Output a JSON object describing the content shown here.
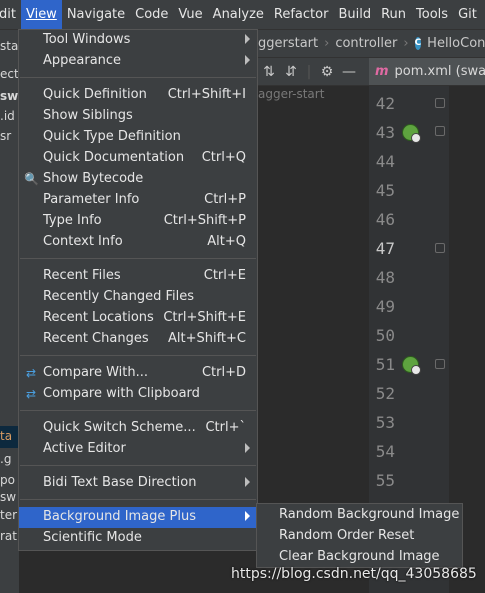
{
  "menubar": {
    "items": [
      "dit",
      "View",
      "Navigate",
      "Code",
      "Vue",
      "Analyze",
      "Refactor",
      "Build",
      "Run",
      "Tools",
      "Git",
      "W"
    ]
  },
  "breadcrumbs": [
    "ggerstart",
    "controller",
    "HelloContro"
  ],
  "tab": {
    "label": "pom.xml (swag"
  },
  "left_panel": {
    "texts": [
      "start",
      "ect",
      "swag",
      ".id",
      "sr",
      "ta",
      ".g",
      "po",
      "sw",
      "ter",
      "rat"
    ]
  },
  "project_label": "agger-start",
  "line_numbers": [
    "42",
    "43",
    "44",
    "45",
    "46",
    "47",
    "48",
    "49",
    "50",
    "51",
    "52",
    "53",
    "54",
    "55"
  ],
  "view_menu": {
    "groups": [
      [
        {
          "label": "Tool Windows",
          "shortcut": "",
          "submenu": true
        },
        {
          "label": "Appearance",
          "shortcut": "",
          "submenu": true
        }
      ],
      [
        {
          "label": "Quick Definition",
          "shortcut": "Ctrl+Shift+I"
        },
        {
          "label": "Show Siblings",
          "shortcut": ""
        },
        {
          "label": "Quick Type Definition",
          "shortcut": ""
        },
        {
          "label": "Quick Documentation",
          "shortcut": "Ctrl+Q"
        },
        {
          "label": "Show Bytecode",
          "shortcut": "",
          "icon": "bytecode-icon"
        },
        {
          "label": "Parameter Info",
          "shortcut": "Ctrl+P"
        },
        {
          "label": "Type Info",
          "shortcut": "Ctrl+Shift+P"
        },
        {
          "label": "Context Info",
          "shortcut": "Alt+Q"
        }
      ],
      [
        {
          "label": "Recent Files",
          "shortcut": "Ctrl+E"
        },
        {
          "label": "Recently Changed Files",
          "shortcut": ""
        },
        {
          "label": "Recent Locations",
          "shortcut": "Ctrl+Shift+E"
        },
        {
          "label": "Recent Changes",
          "shortcut": "Alt+Shift+C"
        }
      ],
      [
        {
          "label": "Compare With...",
          "shortcut": "Ctrl+D",
          "icon": "compare-icon"
        },
        {
          "label": "Compare with Clipboard",
          "shortcut": "",
          "icon": "clipboard-compare-icon"
        }
      ],
      [
        {
          "label": "Quick Switch Scheme...",
          "shortcut": "Ctrl+`"
        },
        {
          "label": "Active Editor",
          "shortcut": "",
          "submenu": true
        }
      ],
      [
        {
          "label": "Bidi Text Base Direction",
          "shortcut": "",
          "submenu": true
        }
      ],
      [
        {
          "label": "Background Image Plus",
          "shortcut": "",
          "submenu": true,
          "highlighted": true
        },
        {
          "label": "Scientific Mode",
          "shortcut": ""
        }
      ]
    ]
  },
  "submenu": {
    "items": [
      "Random Background Image",
      "Random Order Reset",
      "Clear Background Image"
    ]
  },
  "watermark": "https://blog.csdn.net/qq_43058685",
  "colors": {
    "highlight": "#2f65ca",
    "menu_bg": "#3c3f41",
    "editor_bg": "#2b2b2b"
  }
}
